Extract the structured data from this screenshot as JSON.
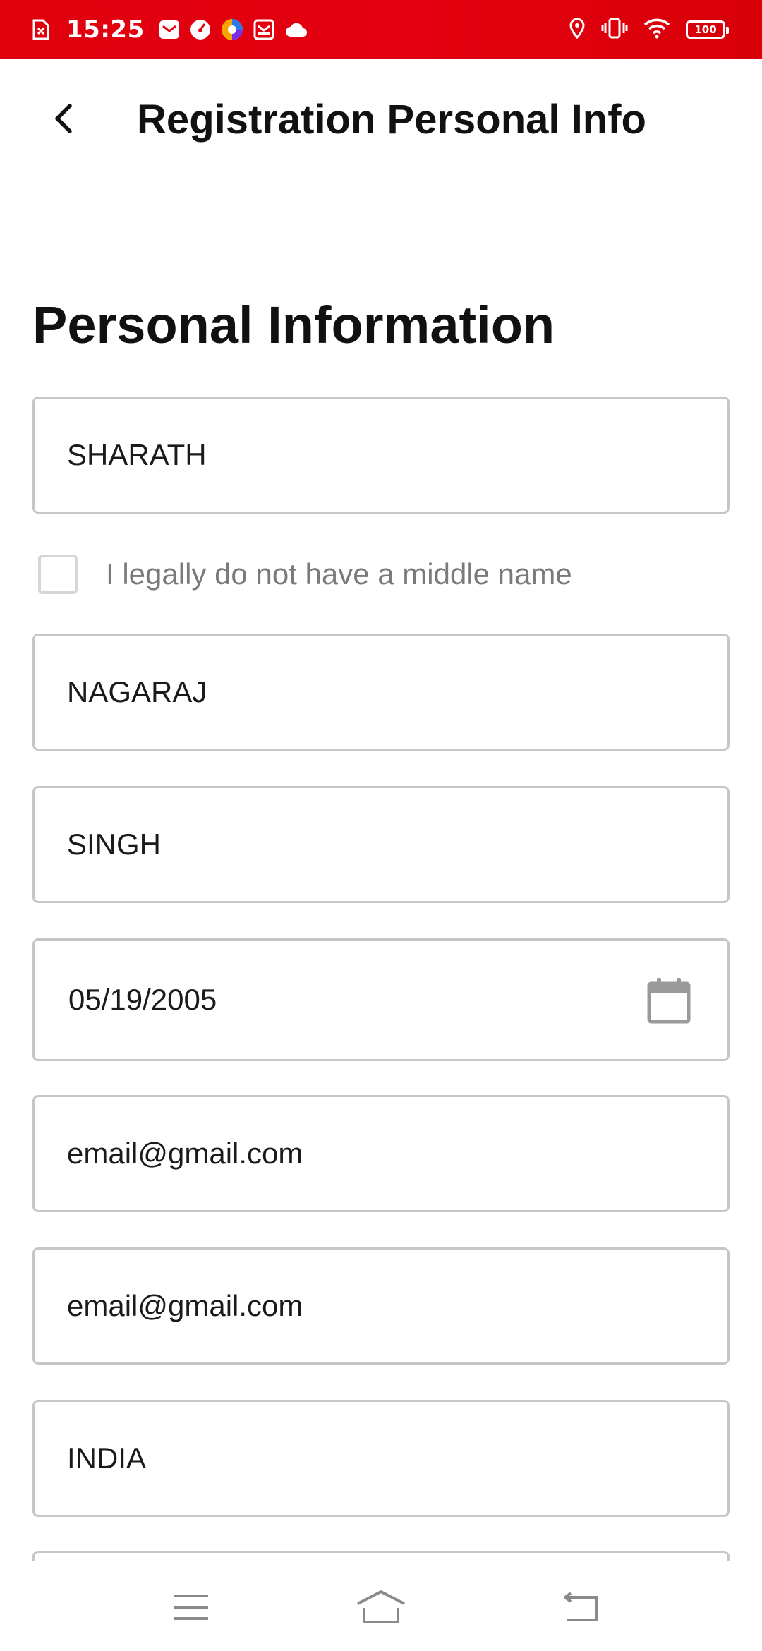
{
  "status_bar": {
    "time": "15:25",
    "battery": "100",
    "left_icons": [
      "doc-x-icon",
      "mail-icon",
      "speed-icon",
      "browser-icon",
      "inbox-icon",
      "cloud-icon"
    ],
    "right_icons": [
      "location-icon",
      "vibrate-icon",
      "wifi-icon",
      "battery-icon"
    ],
    "color": "#e0000e"
  },
  "header": {
    "title": "Registration Personal Info"
  },
  "form": {
    "section_title": "Personal Information",
    "first_name": "SHARATH",
    "no_middle_name_label": "I legally do not have a middle name",
    "no_middle_name_checked": false,
    "middle_name": "NAGARAJ",
    "last_name": "SINGH",
    "date_of_birth": "05/19/2005",
    "email": "email@gmail.com",
    "confirm_email": "email@gmail.com",
    "country": "INDIA"
  },
  "nav_bar": {
    "icons": [
      "menu-icon",
      "home-icon",
      "back-nav-icon"
    ]
  }
}
